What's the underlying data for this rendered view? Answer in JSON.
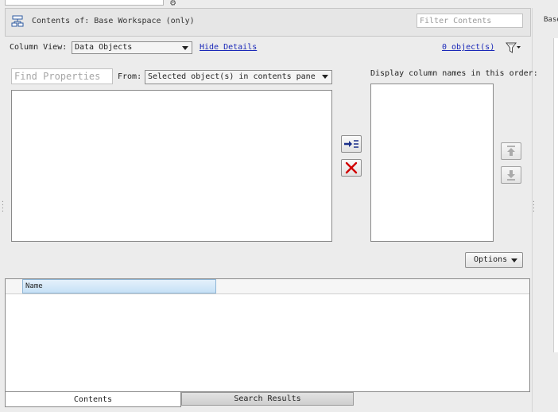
{
  "header": {
    "contents_title": "Contents of: Base Workspace (only)",
    "filter_placeholder": "Filter Contents"
  },
  "right_panel": {
    "label": "Base"
  },
  "column_view": {
    "label": "Column View:",
    "selected": "Data Objects",
    "hide_details": "Hide Details",
    "object_count": "0 object(s)"
  },
  "properties": {
    "find_placeholder": "Find Properties",
    "from_label": "From:",
    "from_selected": "Selected object(s) in contents pane",
    "display_order_label": "Display column names in this order:"
  },
  "options_label": "Options",
  "table": {
    "columns": [
      "Name"
    ]
  },
  "tabs": [
    {
      "label": "Contents",
      "active": true
    },
    {
      "label": "Search Results",
      "active": false
    }
  ],
  "icons": {
    "workspace": "workspace-icon",
    "filter": "funnel-icon",
    "add": "add-column-icon",
    "remove": "remove-column-icon",
    "up": "move-up-icon",
    "down": "move-down-icon"
  },
  "colors": {
    "link": "#1a28b8",
    "remove_x": "#d10000",
    "header_selected": "#c6e1f6"
  }
}
